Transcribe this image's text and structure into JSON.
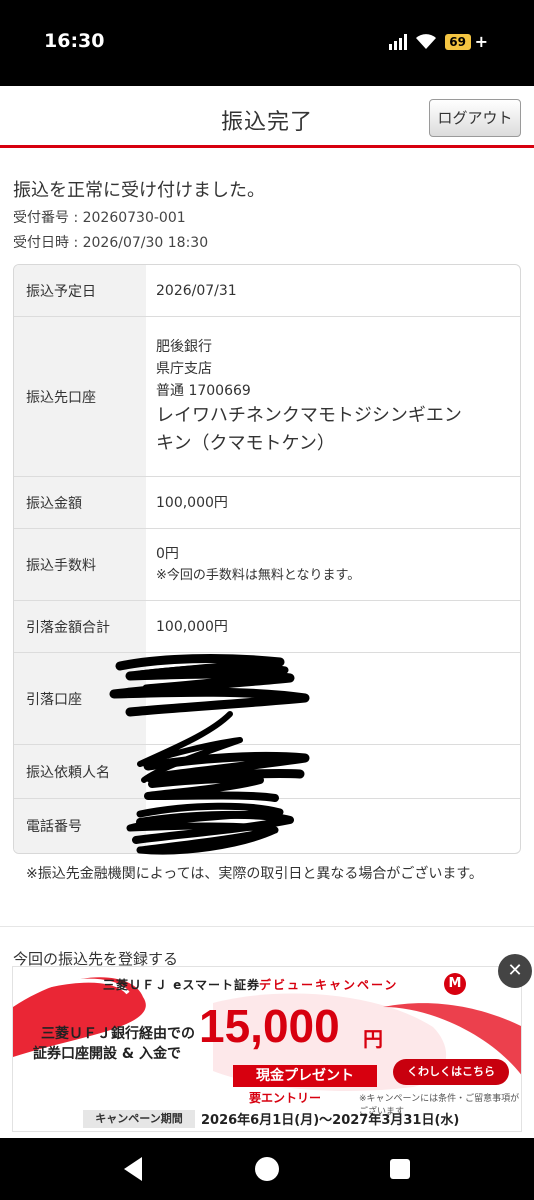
{
  "status_bar": {
    "time": "16:30",
    "battery": "69"
  },
  "header": {
    "title": "振込完了",
    "logout_label": "ログアウト"
  },
  "result": {
    "message": "振込を正常に受け付けました。",
    "receipt_number": "受付番号 : 20260730-001",
    "receipt_datetime": "受付日時 : 2026/07/30 18:30"
  },
  "details": {
    "scheduled_date": {
      "label": "振込予定日",
      "value": "2026/07/31"
    },
    "destination": {
      "label": "振込先口座",
      "bank": "肥後銀行",
      "branch": "県庁支店",
      "account": "普通 1700669",
      "name_line1": "レイワハチネンクマモトジシンギエン",
      "name_line2": "キン（クマモトケン）"
    },
    "amount": {
      "label": "振込金額",
      "value": "100,000円"
    },
    "fee": {
      "label": "振込手数料",
      "value": "0円",
      "note": "※今回の手数料は無料となります。"
    },
    "total": {
      "label": "引落金額合計",
      "value": "100,000円"
    },
    "debit_account": {
      "label": "引落口座"
    },
    "requester": {
      "label": "振込依頼人名"
    },
    "phone": {
      "label": "電話番号"
    }
  },
  "footnote": "※振込先金融機関によっては、実際の取引日と異なる場合がございます。",
  "register_link": "今回の振込先を登録する",
  "ad": {
    "brand": "三菱ＵＦＪ eスマート証券",
    "campaign": "デビューキャンペーン",
    "logo_letter": "M",
    "line1": "三菱ＵＦＪ銀行経由での",
    "line2": "証券口座開設 & 入金で",
    "amount": "15,000",
    "yen": "円",
    "present": "現金プレゼント",
    "entry": "要エントリー",
    "button": "くわしくはこちら",
    "conditions": "※キャンペーンには条件・ご留意事項がございます",
    "period_label": "キャンペーン期間",
    "period": "2026年6月1日(月)〜2027年3月31日(水)"
  },
  "ad_close": "✕",
  "colors": {
    "accent": "#d7000f",
    "label_bg": "#f2f2f2"
  }
}
